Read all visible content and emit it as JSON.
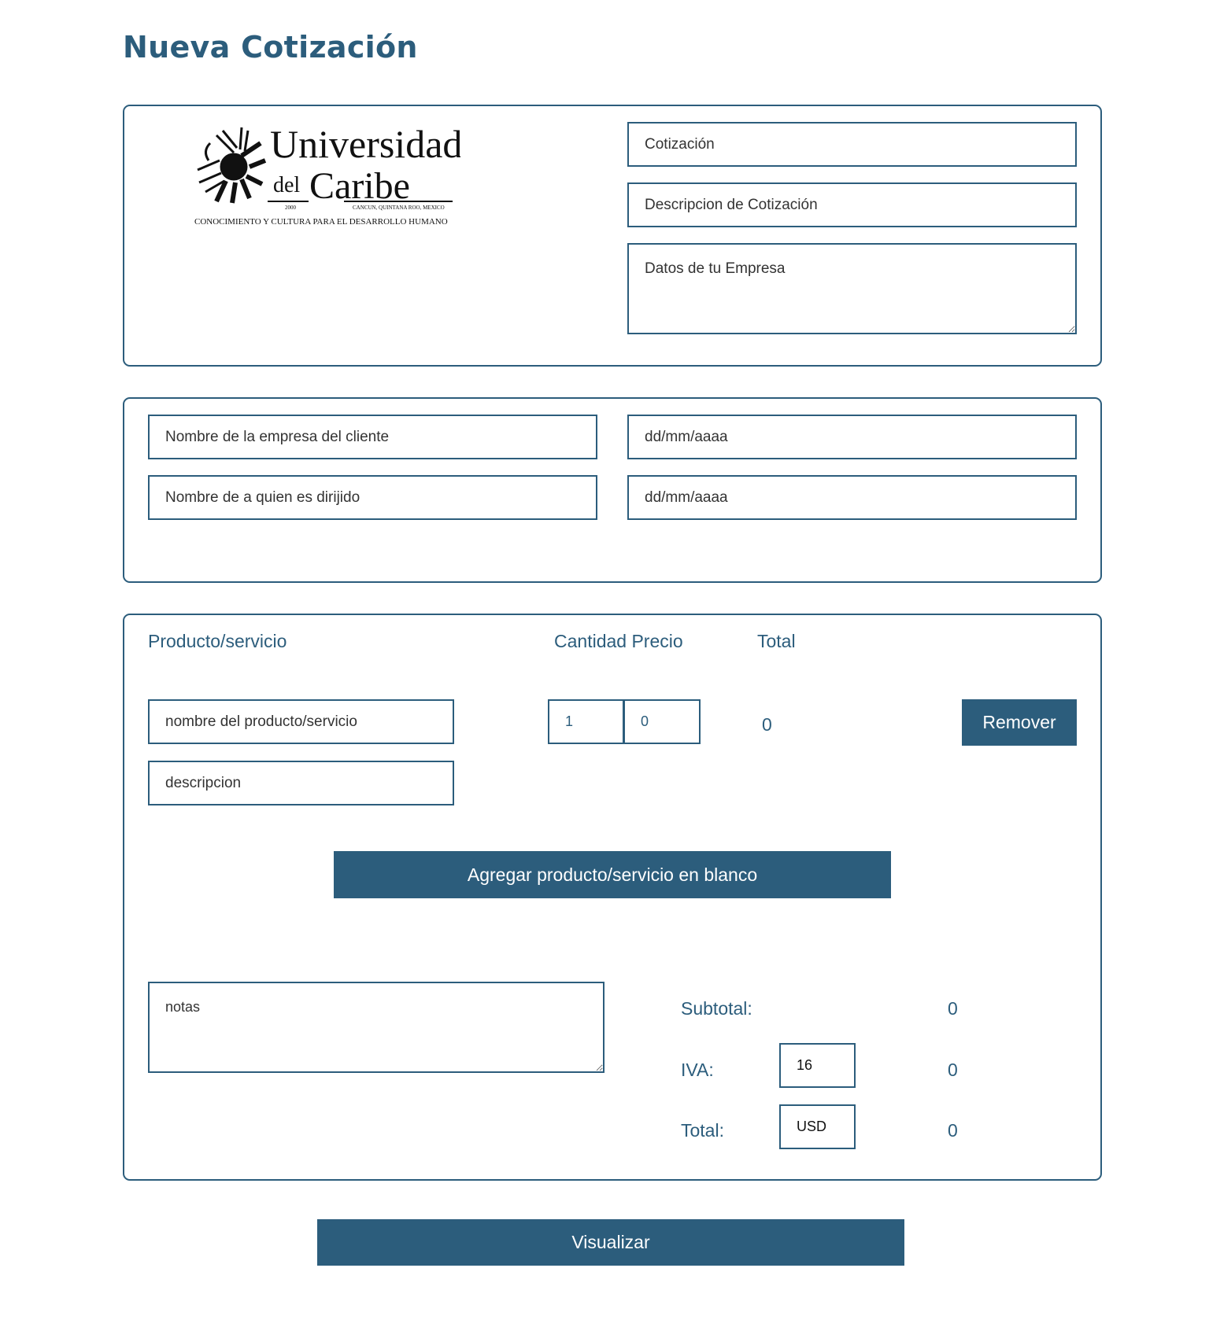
{
  "page": {
    "title": "Nueva Cotización"
  },
  "logo": {
    "name_line1": "Universidad",
    "name_del": "del",
    "name_line2": "Caribe",
    "year": "2000",
    "location": "CANCUN, QUINTANA ROO, MEXICO",
    "tagline": "CONOCIMIENTO Y CULTURA PARA EL DESARROLLO HUMANO"
  },
  "header_card": {
    "cotizacion_placeholder": "Cotización",
    "descripcion_placeholder": "Descripcion de Cotización",
    "empresa_placeholder": "Datos de tu Empresa"
  },
  "client_card": {
    "cliente_placeholder": "Nombre de la empresa del cliente",
    "dirigido_placeholder": "Nombre de a quien es dirijido",
    "fecha1_placeholder": "dd/mm/aaaa",
    "fecha2_placeholder": "dd/mm/aaaa"
  },
  "items": {
    "headers": {
      "producto": "Producto/servicio",
      "cantidad_precio": "Cantidad Precio",
      "total": "Total"
    },
    "rows": [
      {
        "nombre_placeholder": "nombre del producto/servicio",
        "descripcion_placeholder": "descripcion",
        "cantidad": "1",
        "precio": "0",
        "total": "0",
        "remove_label": "Remover"
      }
    ],
    "add_label": "Agregar producto/servicio en blanco"
  },
  "notes": {
    "placeholder": "notas"
  },
  "summary": {
    "subtotal_label": "Subtotal:",
    "subtotal_value": "0",
    "iva_label": "IVA:",
    "iva_rate": "16",
    "iva_value": "0",
    "total_label": "Total:",
    "currency": "USD",
    "total_value": "0"
  },
  "actions": {
    "visualizar_label": "Visualizar"
  },
  "colors": {
    "accent": "#2c5d7c",
    "background": "#ffffff"
  }
}
